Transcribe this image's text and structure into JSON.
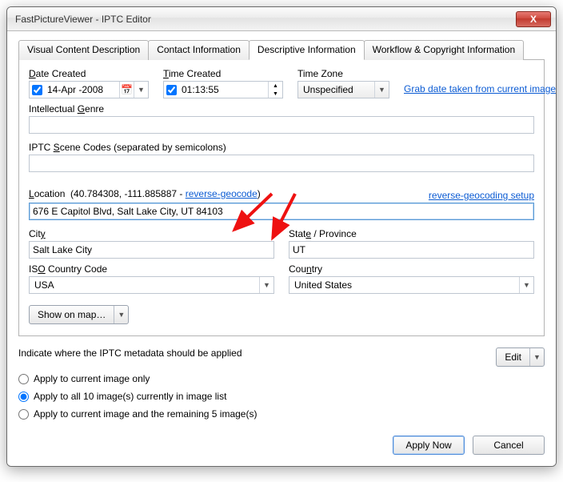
{
  "window": {
    "title": "FastPictureViewer - IPTC Editor",
    "close": "X"
  },
  "tabs": {
    "visual": "Visual Content Description",
    "contact": "Contact Information",
    "descriptive": "Descriptive Information",
    "workflow": "Workflow & Copyright Information"
  },
  "panel": {
    "date_label": "Date Created",
    "date_value": "14-Apr -2008",
    "time_label": "Time Created",
    "time_value": "01:13:55",
    "tz_label": "Time Zone",
    "tz_value": "Unspecified",
    "grab_link": "Grab date taken from current image",
    "genre_label": "Intellectual Genre",
    "genre_value": "",
    "scene_label": "IPTC Scene Codes (separated by semicolons)",
    "scene_value": "",
    "location_label_prefix": "Location  (40.784308, -111.885887 - ",
    "location_geocode_link": "reverse-geocode",
    "location_label_suffix": ")",
    "rgc_setup": "reverse-geocoding setup",
    "location_value": "676 E Capitol Blvd, Salt Lake City, UT 84103",
    "city_label": "City",
    "city_value": "Salt Lake City",
    "state_label": "State / Province",
    "state_value": "UT",
    "iso_label": "ISO Country Code",
    "iso_value": "USA",
    "country_label": "Country",
    "country_value": "United States",
    "map_btn": "Show on map…"
  },
  "lower": {
    "prompt": "Indicate where the IPTC metadata should be applied",
    "edit_btn": "Edit",
    "r1": "Apply to current image only",
    "r2": "Apply to all 10 image(s) currently in image list",
    "r3": "Apply to current image and the remaining 5 image(s)",
    "apply": "Apply Now",
    "cancel": "Cancel"
  }
}
